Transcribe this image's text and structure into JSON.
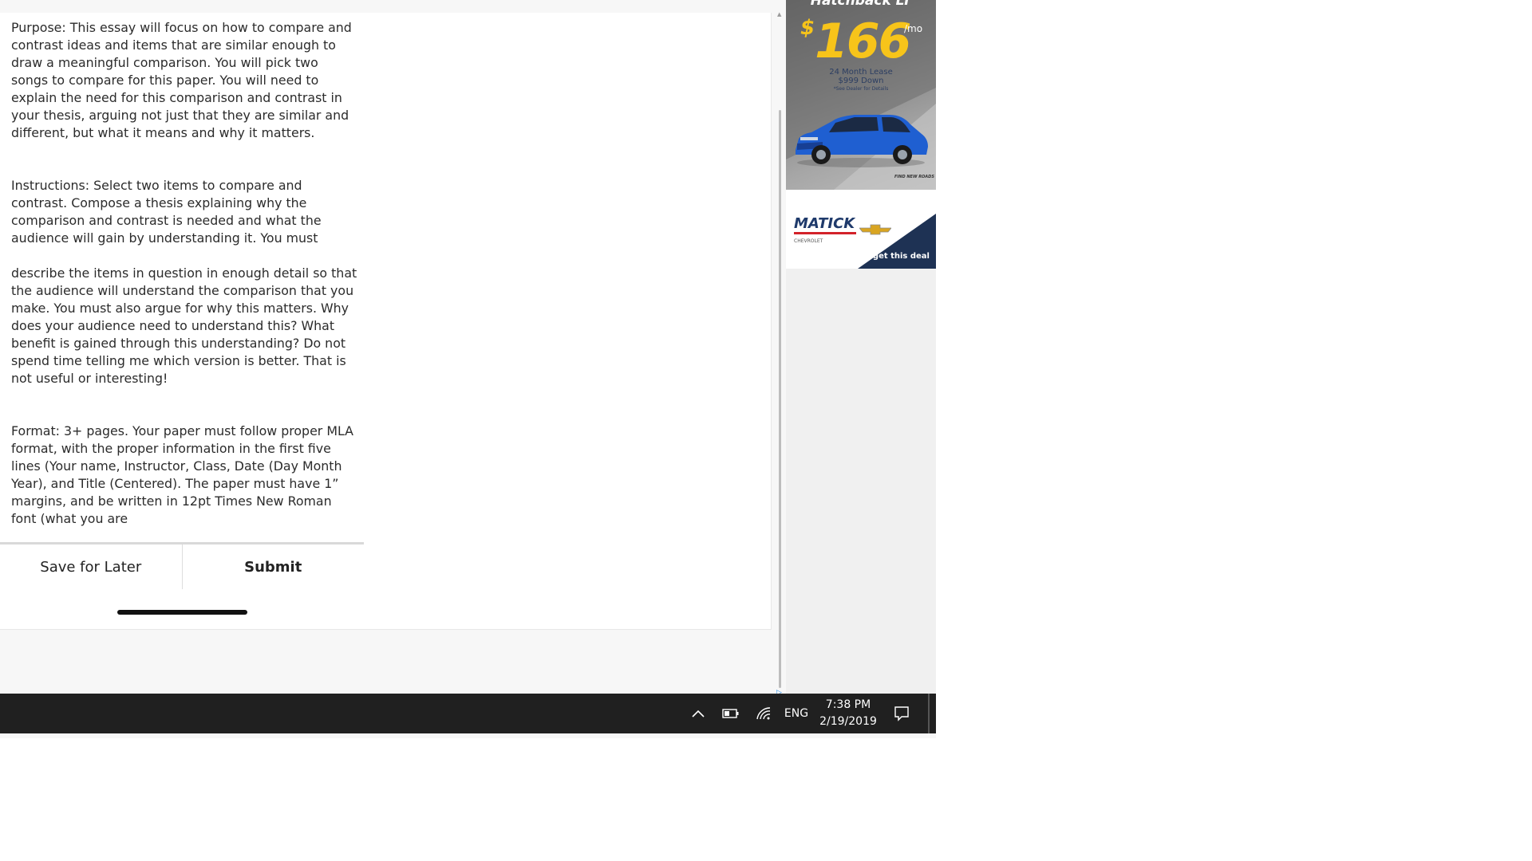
{
  "assignment": {
    "paragraphs": [
      "Purpose: This essay will focus on how to compare and contrast ideas and items that are similar enough to draw a meaningful comparison. You will pick two songs to compare for this paper. You will need to explain the need for this comparison and contrast in your thesis, arguing not just that they are similar and different, but what it means and why it matters.",
      "Instructions: Select two items to compare and contrast. Compose a thesis explaining why the comparison and contrast is needed and what the audience will gain by understanding it. You must",
      "describe the items in question in enough detail so that the audience will understand the comparison that you make. You must also argue for why this matters. Why does your audience need to understand this? What benefit is gained through this understanding? Do not spend time telling me which version is better. That is not useful or interesting!",
      "Format: 3+ pages. Your paper must follow proper MLA format, with the proper information in the first five lines (Your name, Instructor, Class, Date (Day Month Year), and Title (Centered). The paper must have 1” margins, and be written in 12pt Times New Roman font (what you are"
    ]
  },
  "actions": {
    "save_label": "Save for Later",
    "submit_label": "Submit"
  },
  "ad": {
    "headline": "Hatchback LT",
    "price_symbol": "$",
    "price_amount": "166",
    "price_period": "/mo",
    "lease_line1": "24 Month Lease",
    "lease_line2": "$999 Down",
    "disclaimer": "*See Dealer for Details",
    "partner": "FIND NEW ROADS",
    "dealer_name": "MATICK",
    "dealer_brand": "CHEVROLET",
    "cta": "get this deal",
    "colors": {
      "price": "#f7c41a",
      "dealer_blue": "#1f3a6b",
      "car_blue": "#1f5fd1",
      "cta_band": "#1e3254"
    }
  },
  "taskbar": {
    "language": "ENG",
    "time": "7:38 PM",
    "date": "2/19/2019",
    "tray_icons": [
      "chevron-up-icon",
      "battery-icon",
      "wifi-icon",
      "notification-icon"
    ],
    "background": "#202020"
  }
}
